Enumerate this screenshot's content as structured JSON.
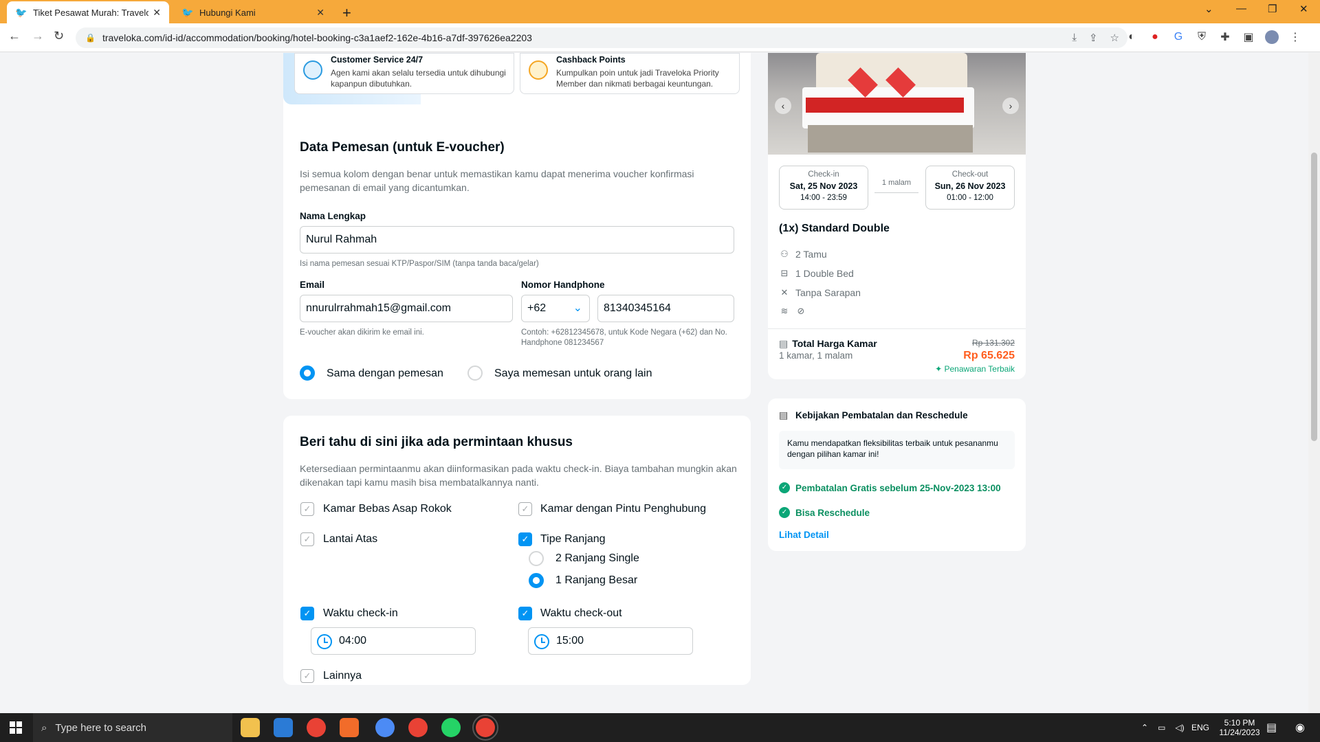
{
  "browser": {
    "tabs": [
      {
        "title": "Tiket Pesawat Murah: Traveloka",
        "active": true
      },
      {
        "title": "Hubungi Kami",
        "active": false
      }
    ],
    "url": "traveloka.com/id-id/accommodation/booking/hotel-booking-c3a1aef2-162e-4b16-a7df-397626ea2203"
  },
  "benefits": [
    {
      "title": "Customer Service 24/7",
      "desc": "Agen kami akan selalu tersedia untuk dihubungi kapanpun dibutuhkan."
    },
    {
      "title": "Cashback Points",
      "desc": "Kumpulkan poin untuk jadi Traveloka Priority Member dan nikmati berbagai keuntungan."
    }
  ],
  "contact": {
    "title": "Data Pemesan (untuk E-voucher)",
    "subtitle": "Isi semua kolom dengan benar untuk memastikan kamu dapat menerima voucher konfirmasi pemesanan di email yang dicantumkan.",
    "name_label": "Nama Lengkap",
    "name_value": "Nurul Rahmah",
    "name_hint": "Isi nama pemesan sesuai KTP/Paspor/SIM (tanpa tanda baca/gelar)",
    "email_label": "Email",
    "email_value": "nnurulrrahmah15@gmail.com",
    "email_hint": "E-voucher akan dikirim ke email ini.",
    "phone_label": "Nomor Handphone",
    "country_code": "+62",
    "phone_value": "81340345164",
    "phone_hint": "Contoh: +62812345678, untuk Kode Negara (+62) dan No. Handphone 081234567",
    "guest_option_same": "Sama dengan pemesan",
    "guest_option_other": "Saya memesan untuk orang lain"
  },
  "requests": {
    "title": "Beri tahu di sini jika ada permintaan khusus",
    "subtitle": "Ketersediaan permintaanmu akan diinformasikan pada waktu check-in. Biaya tambahan mungkin akan dikenakan tapi kamu masih bisa membatalkannya nanti.",
    "non_smoking": "Kamar Bebas Asap Rokok",
    "connecting": "Kamar dengan Pintu Penghubung",
    "high_floor": "Lantai Atas",
    "bed_type": "Tipe Ranjang",
    "bed_twin": "2 Ranjang Single",
    "bed_large": "1 Ranjang Besar",
    "checkin_time_label": "Waktu check-in",
    "checkin_time": "04:00",
    "checkout_time_label": "Waktu check-out",
    "checkout_time": "15:00",
    "other": "Lainnya"
  },
  "stay": {
    "checkin_label": "Check-in",
    "checkin_date": "Sat, 25 Nov 2023",
    "checkin_hours": "14:00 - 23:59",
    "nights": "1 malam",
    "checkout_label": "Check-out",
    "checkout_date": "Sun, 26 Nov 2023",
    "checkout_hours": "01:00 - 12:00",
    "room": "(1x) Standard Double",
    "guests": "2 Tamu",
    "bed": "1 Double Bed",
    "breakfast": "Tanpa Sarapan",
    "total_label": "Total Harga Kamar",
    "total_sub": "1 kamar, 1 malam",
    "price_old": "Rp 131.302",
    "price_new": "Rp 65.625",
    "price_tag": "Penawaran Terbaik"
  },
  "policy": {
    "title": "Kebijakan Pembatalan dan Reschedule",
    "note": "Kamu mendapatkan fleksibilitas terbaik untuk pesananmu dengan pilihan kamar ini!",
    "free_cancel": "Pembatalan Gratis sebelum 25-Nov-2023 13:00",
    "reschedule": "Bisa Reschedule",
    "detail": "Lihat Detail"
  },
  "taskbar": {
    "search_placeholder": "Type here to search",
    "lang": "ENG",
    "time": "5:10 PM",
    "date": "11/24/2023"
  },
  "colors": {
    "accent": "#0194f3",
    "price": "#ff5e1f",
    "success": "#0ba677",
    "tabbar": "#f6a93b"
  }
}
